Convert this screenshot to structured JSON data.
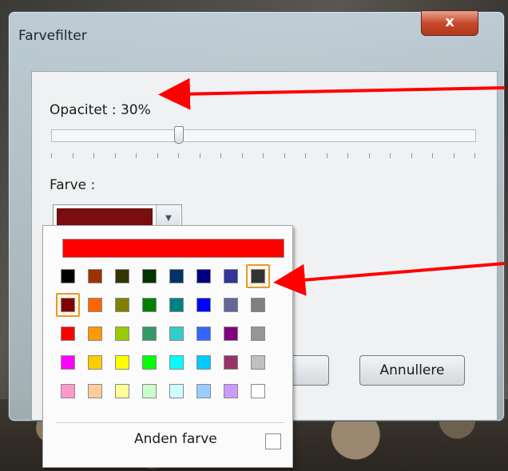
{
  "window": {
    "title": "Farvefilter",
    "close_label": "x"
  },
  "opacity": {
    "label": "Opacitet : 30%",
    "value_percent": 30
  },
  "color": {
    "label": "Farve :",
    "selected": "#7a0d0d"
  },
  "buttons": {
    "cancel_label": "Annullere"
  },
  "palette": {
    "top_bar_color": "#ff0000",
    "rows": [
      [
        "#000000",
        "#993300",
        "#333300",
        "#003300",
        "#003366",
        "#000080",
        "#333399",
        "#333333"
      ],
      [
        "#800000",
        "#ff6600",
        "#808000",
        "#008000",
        "#008080",
        "#0000ff",
        "#666699",
        "#808080"
      ],
      [
        "#ff0000",
        "#ff9900",
        "#99cc00",
        "#339966",
        "#33cccc",
        "#3366ff",
        "#800080",
        "#969696"
      ],
      [
        "#ff00ff",
        "#ffcc00",
        "#ffff00",
        "#00ff00",
        "#00ffff",
        "#00ccff",
        "#993366",
        "#c0c0c0"
      ],
      [
        "#ff99cc",
        "#ffcc99",
        "#ffff99",
        "#ccffcc",
        "#ccffff",
        "#99ccff",
        "#cc99ff",
        "#ffffff"
      ]
    ],
    "highlighted": [
      [
        0,
        7
      ],
      [
        1,
        0
      ]
    ],
    "other_color_label": "Anden farve"
  },
  "annotation_color": "#ff0000"
}
